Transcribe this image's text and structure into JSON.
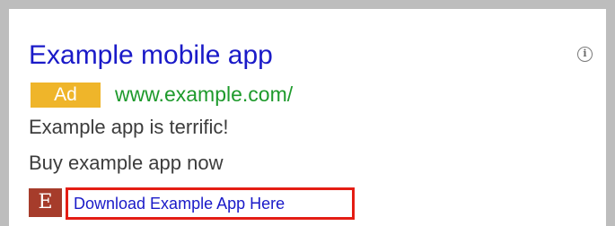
{
  "ad": {
    "headline": "Example mobile app",
    "badge": "Ad",
    "display_url": "www.example.com/",
    "description_line1": "Example app is terrific!",
    "description_line2": "Buy example app now",
    "logo_letter": "E",
    "sitelink": "Download Example App Here",
    "info_icon_glyph": "i"
  },
  "colors": {
    "headline": "#1a1ac8",
    "badge_background": "#efb52a",
    "display_url": "#1e9a2c",
    "logo_background": "#a63c2b",
    "highlight_border": "#e41d14",
    "frame_border": "#bdbdbd"
  },
  "icons": {
    "info": "info-icon"
  }
}
